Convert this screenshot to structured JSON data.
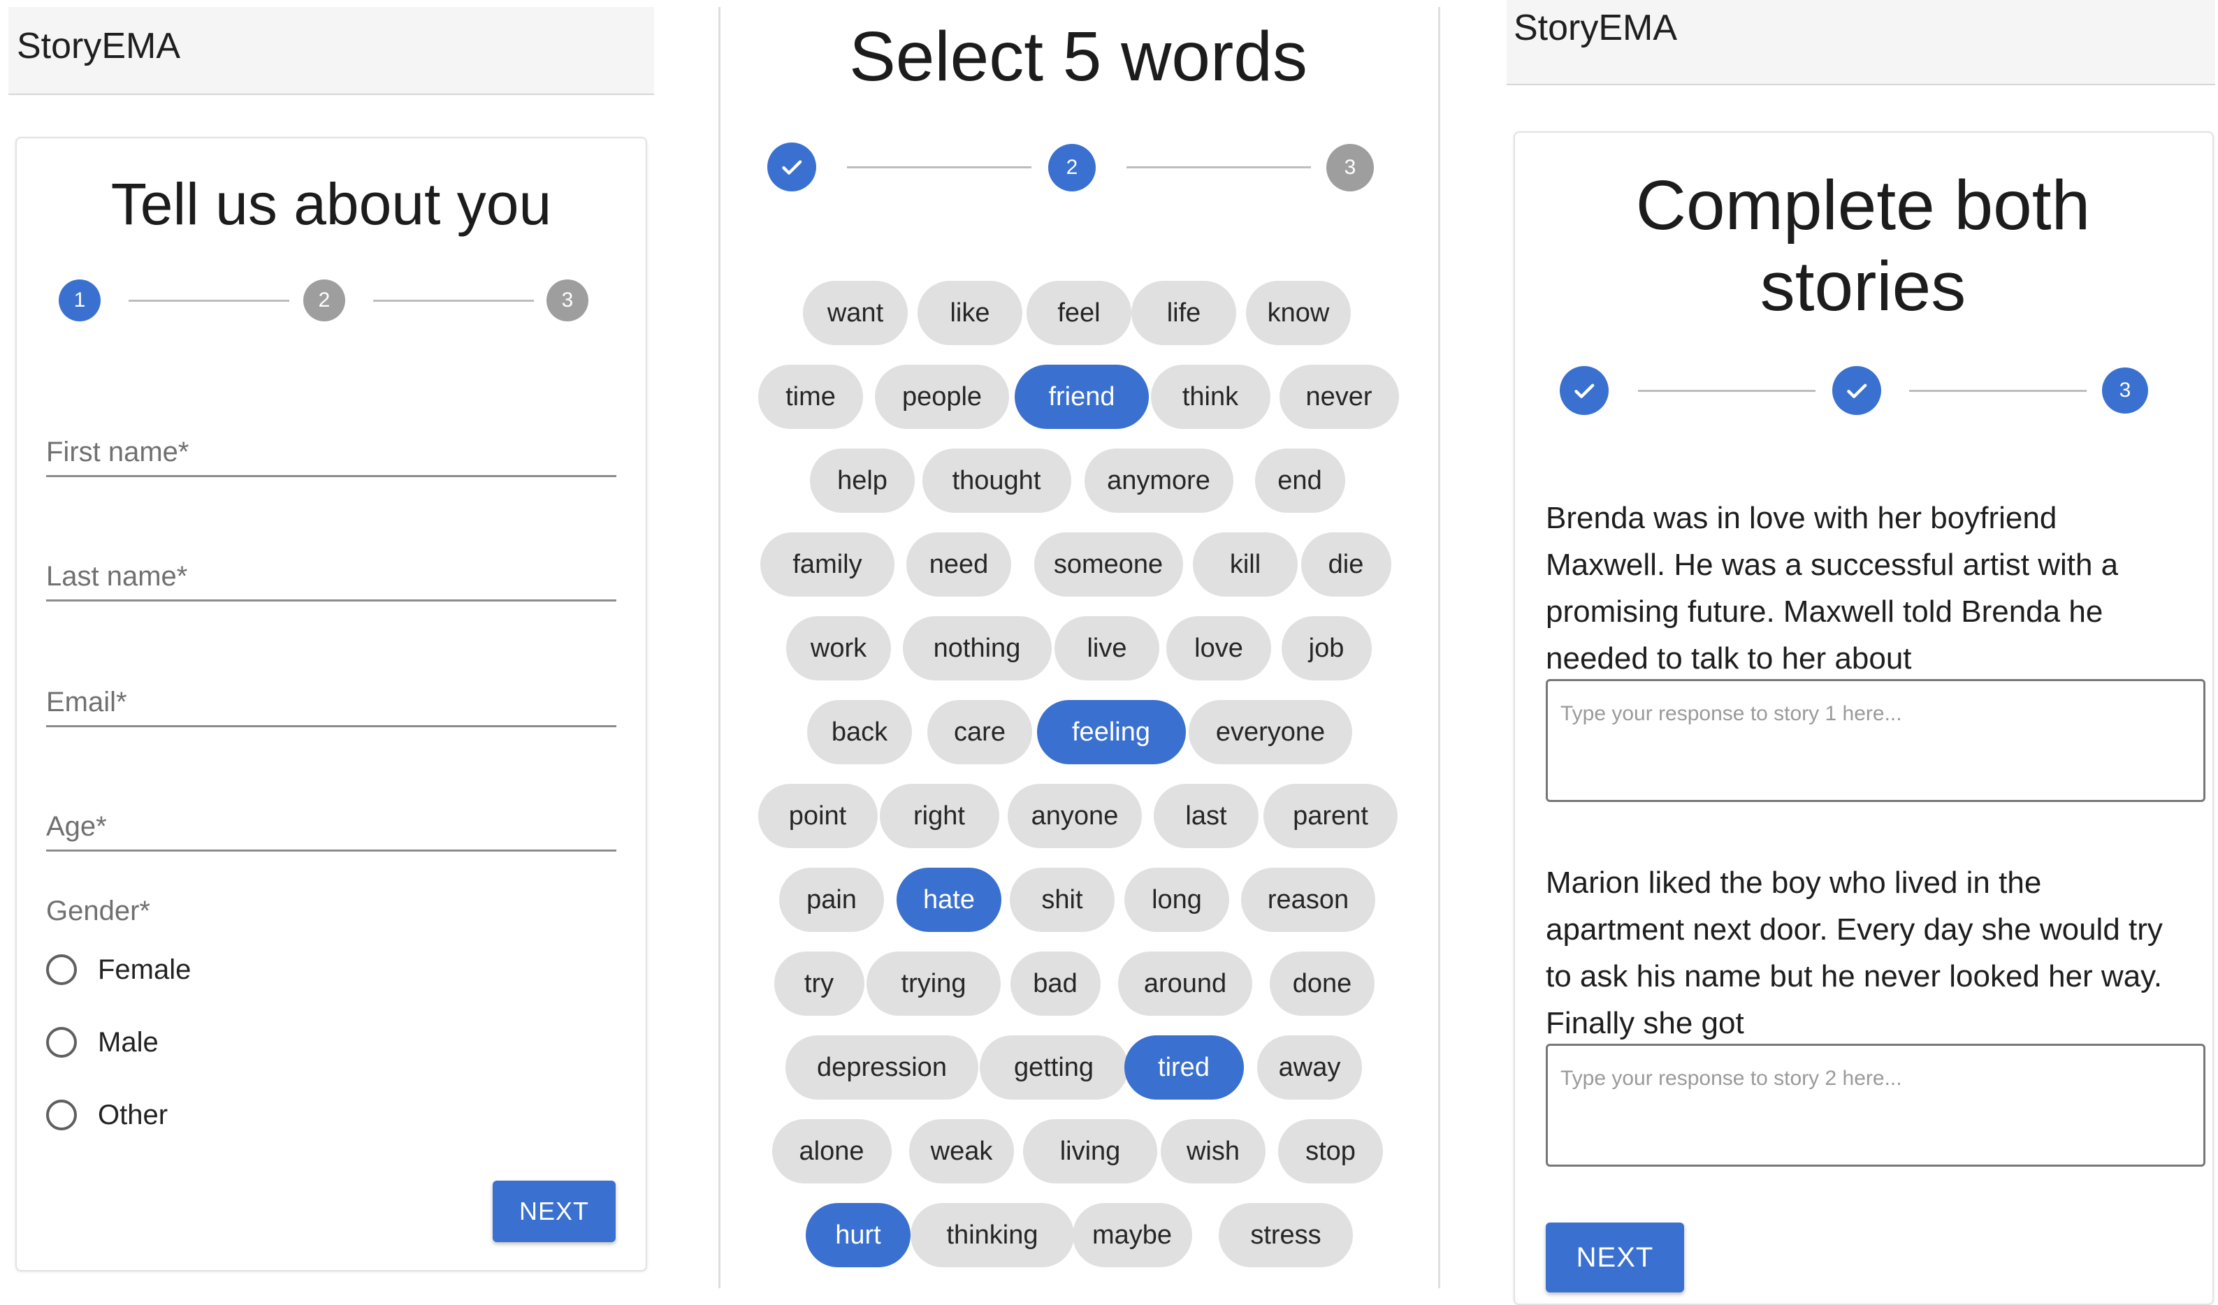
{
  "app_title": "StoryEMA",
  "panel1": {
    "heading": "Tell us about you",
    "steps": [
      "1",
      "2",
      "3"
    ],
    "fields": {
      "first_name": "First name*",
      "last_name": "Last name*",
      "email": "Email*",
      "age": "Age*"
    },
    "gender": {
      "label": "Gender*",
      "options": [
        "Female",
        "Male",
        "Other"
      ]
    },
    "next_label": "NEXT"
  },
  "panel2": {
    "heading": "Select 5 words",
    "steps": [
      "check",
      "2",
      "3"
    ],
    "words": [
      [
        "want",
        "like",
        "feel",
        "life",
        "know"
      ],
      [
        "time",
        "people",
        "friend",
        "think",
        "never"
      ],
      [
        "help",
        "thought",
        "anymore",
        "end"
      ],
      [
        "family",
        "need",
        "someone",
        "kill",
        "die"
      ],
      [
        "work",
        "nothing",
        "live",
        "love",
        "job"
      ],
      [
        "back",
        "care",
        "feeling",
        "everyone"
      ],
      [
        "point",
        "right",
        "anyone",
        "last",
        "parent"
      ],
      [
        "pain",
        "hate",
        "shit",
        "long",
        "reason"
      ],
      [
        "try",
        "trying",
        "bad",
        "around",
        "done"
      ],
      [
        "depression",
        "getting",
        "tired",
        "away"
      ],
      [
        "alone",
        "weak",
        "living",
        "wish",
        "stop"
      ],
      [
        "hurt",
        "thinking",
        "maybe",
        "stress"
      ]
    ],
    "selected_words": [
      "friend",
      "feeling",
      "hate",
      "tired",
      "hurt"
    ]
  },
  "panel3": {
    "heading_line1": "Complete both",
    "heading_line2": "stories",
    "steps": [
      "check",
      "check",
      "3"
    ],
    "story1": "Brenda was in love with her boyfriend Maxwell. He was a successful artist with a promising future. Maxwell told Brenda he needed to talk to her about",
    "story1_placeholder": "Type your response to story 1 here...",
    "story2": "Marion liked the boy who lived in the apartment next door. Every day she would try to ask his name but he never looked her way. Finally she got",
    "story2_placeholder": "Type your response to story 2 here...",
    "next_label": "NEXT"
  },
  "colors": {
    "accent": "#3a70cf",
    "inactive_step": "#9e9e9e",
    "chip": "#e0e0e0",
    "appbar": "#f5f5f5"
  }
}
